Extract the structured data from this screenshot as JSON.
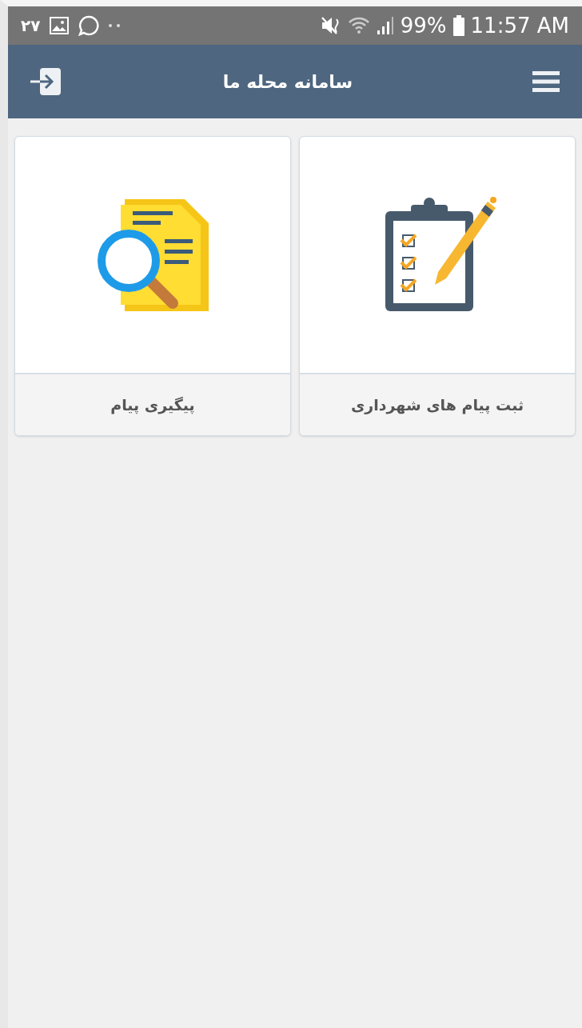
{
  "status_bar": {
    "notification_text": "۲۷",
    "battery": "99%",
    "time": "11:57 AM"
  },
  "header": {
    "title": "سامانه محله ما"
  },
  "tiles": [
    {
      "kind": "clipboard",
      "label": "ثبت پیام های شهرداری"
    },
    {
      "kind": "search",
      "label": "پیگیری پیام"
    }
  ]
}
